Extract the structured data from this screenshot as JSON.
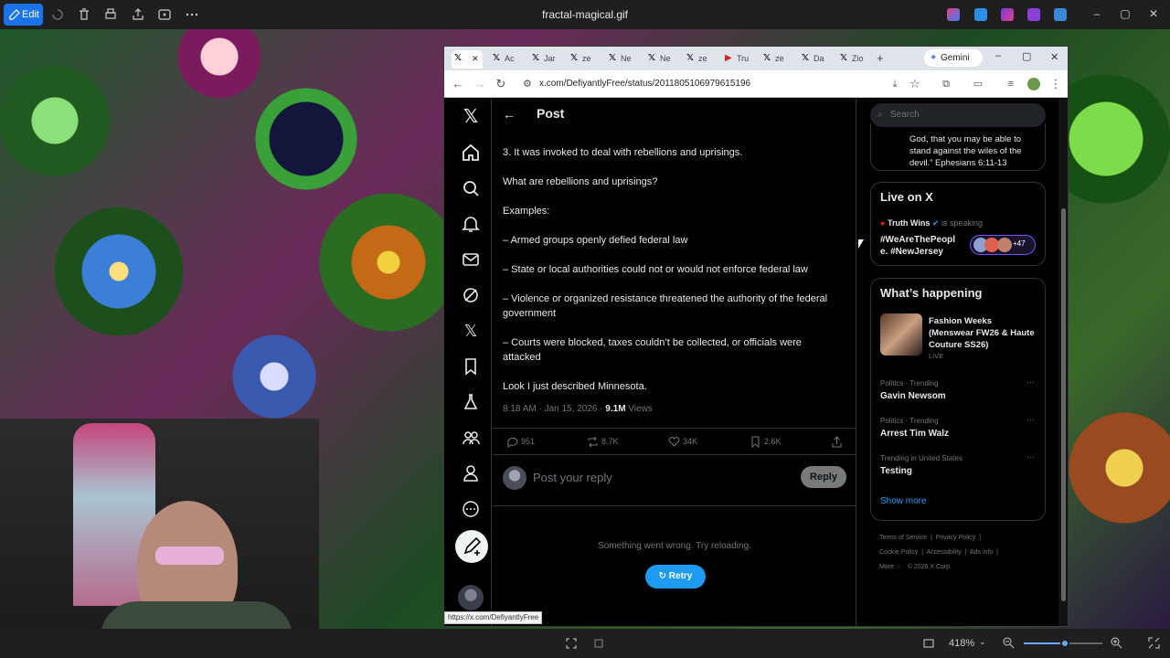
{
  "viewer": {
    "edit_label": "Edit",
    "file_name": "fractal-magical.gif",
    "zoom": "418%"
  },
  "browser": {
    "tabs": [
      {
        "label": "",
        "icon": "x-icon",
        "active": true
      },
      {
        "label": "Ac",
        "icon": "x-icon"
      },
      {
        "label": "Jar",
        "icon": "x-icon"
      },
      {
        "label": "ze",
        "icon": "x-icon"
      },
      {
        "label": "Ne",
        "icon": "x-icon"
      },
      {
        "label": "Ne",
        "icon": "x-icon"
      },
      {
        "label": "ze",
        "icon": "x-icon"
      },
      {
        "label": "Tru",
        "icon": "youtube-icon"
      },
      {
        "label": "ze",
        "icon": "x-icon"
      },
      {
        "label": "Da",
        "icon": "x-icon"
      },
      {
        "label": "Zio",
        "icon": "x-icon"
      }
    ],
    "gemini_label": "Gemini",
    "url": "x.com/DefiyantlyFree/status/2011805106979615196",
    "status_url": "https://x.com/DefiyantlyFree"
  },
  "post": {
    "header_title": "Post",
    "lines": [
      "3. It was invoked to deal with rebellions and uprisings.",
      "What are rebellions and uprisings?",
      "Examples:",
      "– Armed groups openly defied federal law",
      "– State or local authorities could not or would not enforce federal law",
      "– Violence or organized resistance threatened the authority of the federal government",
      "– Courts were blocked, taxes couldn’t be collected, or officials were attacked",
      "Look I just described Minnesota."
    ],
    "time": "8:18 AM · Jan 15, 2026 · ",
    "views_count": "9.1M",
    "views_label": " Views",
    "replies": "951",
    "reposts": "8.7K",
    "likes": "34K",
    "bookmarks": "2.6K",
    "reply_placeholder": "Post your reply",
    "reply_button": "Reply",
    "error_text": "Something went wrong. Try reloading.",
    "retry_label": "Retry"
  },
  "sidebar": {
    "search_placeholder": "Search",
    "quote_text": "God, that you may be able to stand against the wiles of the devil.” Ephesians 6:11-13",
    "live": {
      "title": "Live on X",
      "host": "Truth Wins",
      "status": "is speaking",
      "topic": "#WeAreThePeopl e. #NewJersey",
      "listeners": "+47"
    },
    "happening": {
      "title": "What’s happening",
      "featured_title": "Fashion Weeks (Menswear FW26 & Haute Couture SS26)",
      "featured_status": "LIVE",
      "trends": [
        {
          "context": "Politics · Trending",
          "name": "Gavin Newsom"
        },
        {
          "context": "Politics · Trending",
          "name": "Arrest Tim Walz"
        },
        {
          "context": "Trending in United States",
          "name": "Testing"
        }
      ],
      "show_more": "Show more"
    },
    "footer": {
      "terms": "Terms of Service",
      "privacy": "Privacy Policy",
      "cookie": "Cookie Policy",
      "accessibility": "Accessibility",
      "ads": "Ads info",
      "more": "More ···",
      "copyright": "© 2026 X Corp."
    }
  },
  "colors": {
    "accent": "#1d9bf0",
    "viewer_accent": "#1a73e8",
    "x_background": "#000000"
  }
}
